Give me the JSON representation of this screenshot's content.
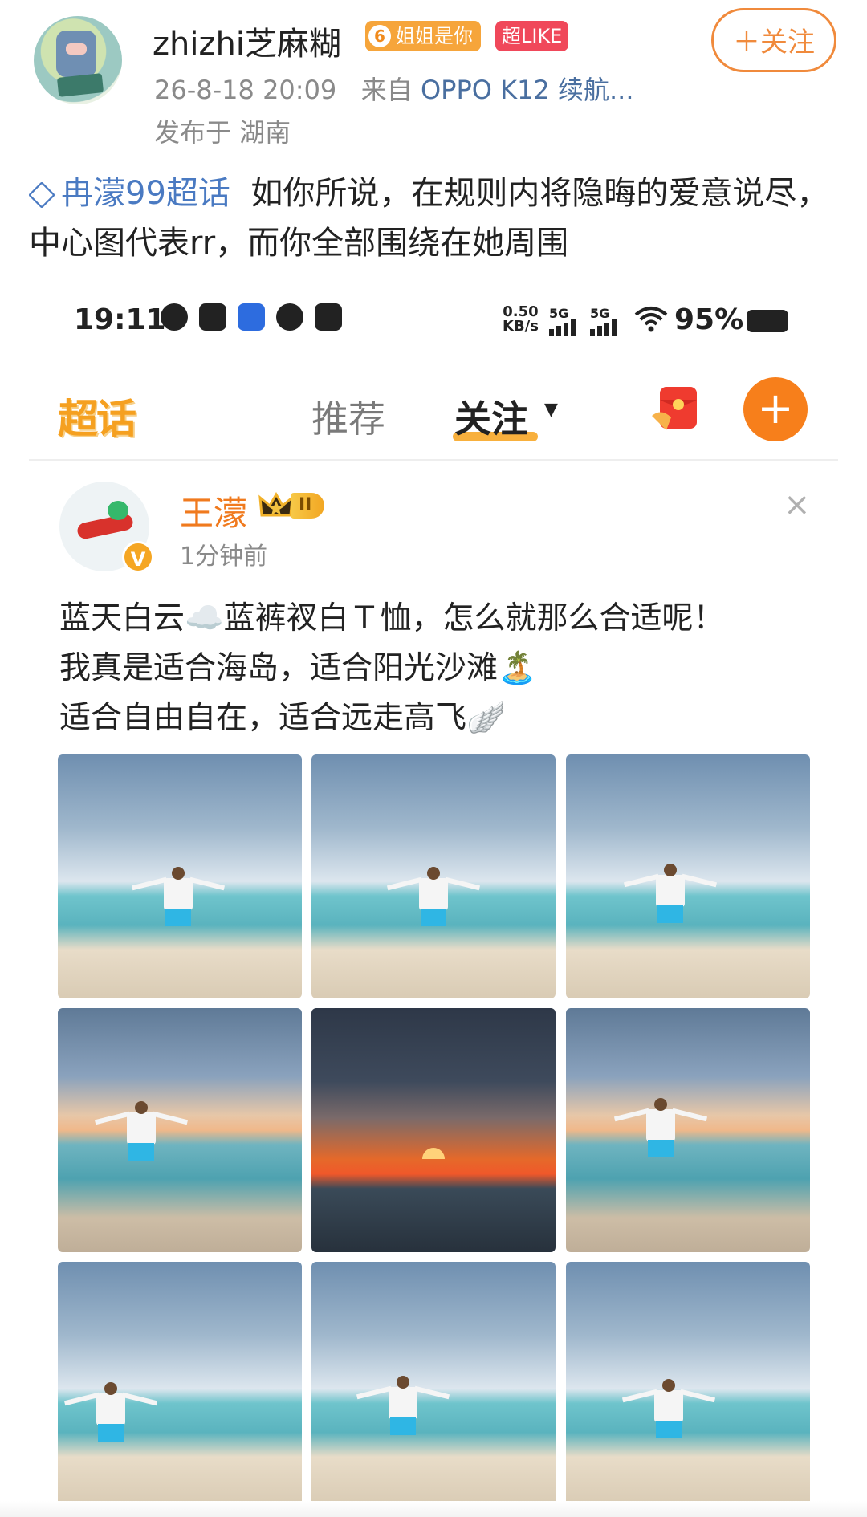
{
  "outer_post": {
    "username": "zhizhi芝麻糊",
    "level_badge": {
      "level": "6",
      "label": "姐姐是你"
    },
    "like_badge": "超LIKE",
    "follow_button": "＋关注",
    "timestamp": "26-8-18 20:09",
    "source_prefix": "来自",
    "source_device": "OPPO K12 续航...",
    "location": "发布于 湖南",
    "topic_link": "冉濛99超话",
    "text": "如你所说，在规则内将隐晦的爱意说尽，中心图代表rr，而你全部围绕在她周围"
  },
  "status_bar": {
    "time": "19:11",
    "net_speed_value": "0.50",
    "net_speed_unit": "KB/s",
    "sim1": "5G",
    "sim2": "5G",
    "battery": "95%",
    "app_icons": [
      "weibo-icon",
      "fishing-icon",
      "app-icon",
      "tiktok-icon",
      "bili-icon"
    ]
  },
  "nav": {
    "logo": "超话",
    "tab_recommend": "推荐",
    "tab_follow": "关注",
    "accent_color": "#f7a21b"
  },
  "inner_post": {
    "name": "王濛",
    "level": "II",
    "time": "1分钟前",
    "verified_mark": "V",
    "close_icon": "×",
    "lines": [
      "蓝天白云☁️蓝裤衩白Ｔ恤，怎么就那么合适呢！",
      "我真是适合海岛，适合阳光沙滩🏝️",
      "适合自由自在，适合远走高飞🪽"
    ]
  },
  "photos": [
    {
      "scene": "beach-day"
    },
    {
      "scene": "beach-day"
    },
    {
      "scene": "beach-day"
    },
    {
      "scene": "beach-dusk"
    },
    {
      "scene": "sunset"
    },
    {
      "scene": "beach-dusk"
    },
    {
      "scene": "beach-day"
    },
    {
      "scene": "beach-day"
    },
    {
      "scene": "beach-day"
    }
  ]
}
